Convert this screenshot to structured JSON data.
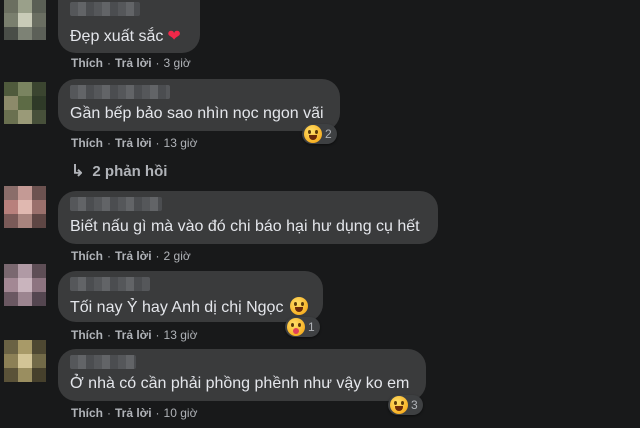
{
  "comments": [
    {
      "text": "Đẹp xuất sắc",
      "like": "Thích",
      "reply": "Trả lời",
      "time": "3 giờ"
    },
    {
      "text": "Gần bếp bảo sao nhìn nọc ngon vãi",
      "like": "Thích",
      "reply": "Trả lời",
      "time": "13 giờ",
      "reaction_count": "2",
      "reaction_icon": "laughing-emoji-icon"
    },
    {
      "text": "Biết nấu gì mà vào đó chi báo hại hư dụng cụ hết",
      "like": "Thích",
      "reply": "Trả lời",
      "time": "2 giờ"
    },
    {
      "text": "Tối nay Ỷ hay Anh dị chị Ngọc",
      "like": "Thích",
      "reply": "Trả lời",
      "time": "13 giờ",
      "reaction_count": "1",
      "reaction_icon": "care-emoji-icon"
    },
    {
      "text": "Ở nhà có cần phải phồng phềnh như vậy ko em",
      "like": "Thích",
      "reply": "Trả lời",
      "time": "10 giờ",
      "reaction_count": "3",
      "reaction_icon": "laughing-emoji-icon"
    }
  ],
  "replies_link": "2 phản hồi",
  "colors": {
    "background": "#18191a",
    "bubble": "#3a3b3c",
    "heart": "#f02849"
  }
}
